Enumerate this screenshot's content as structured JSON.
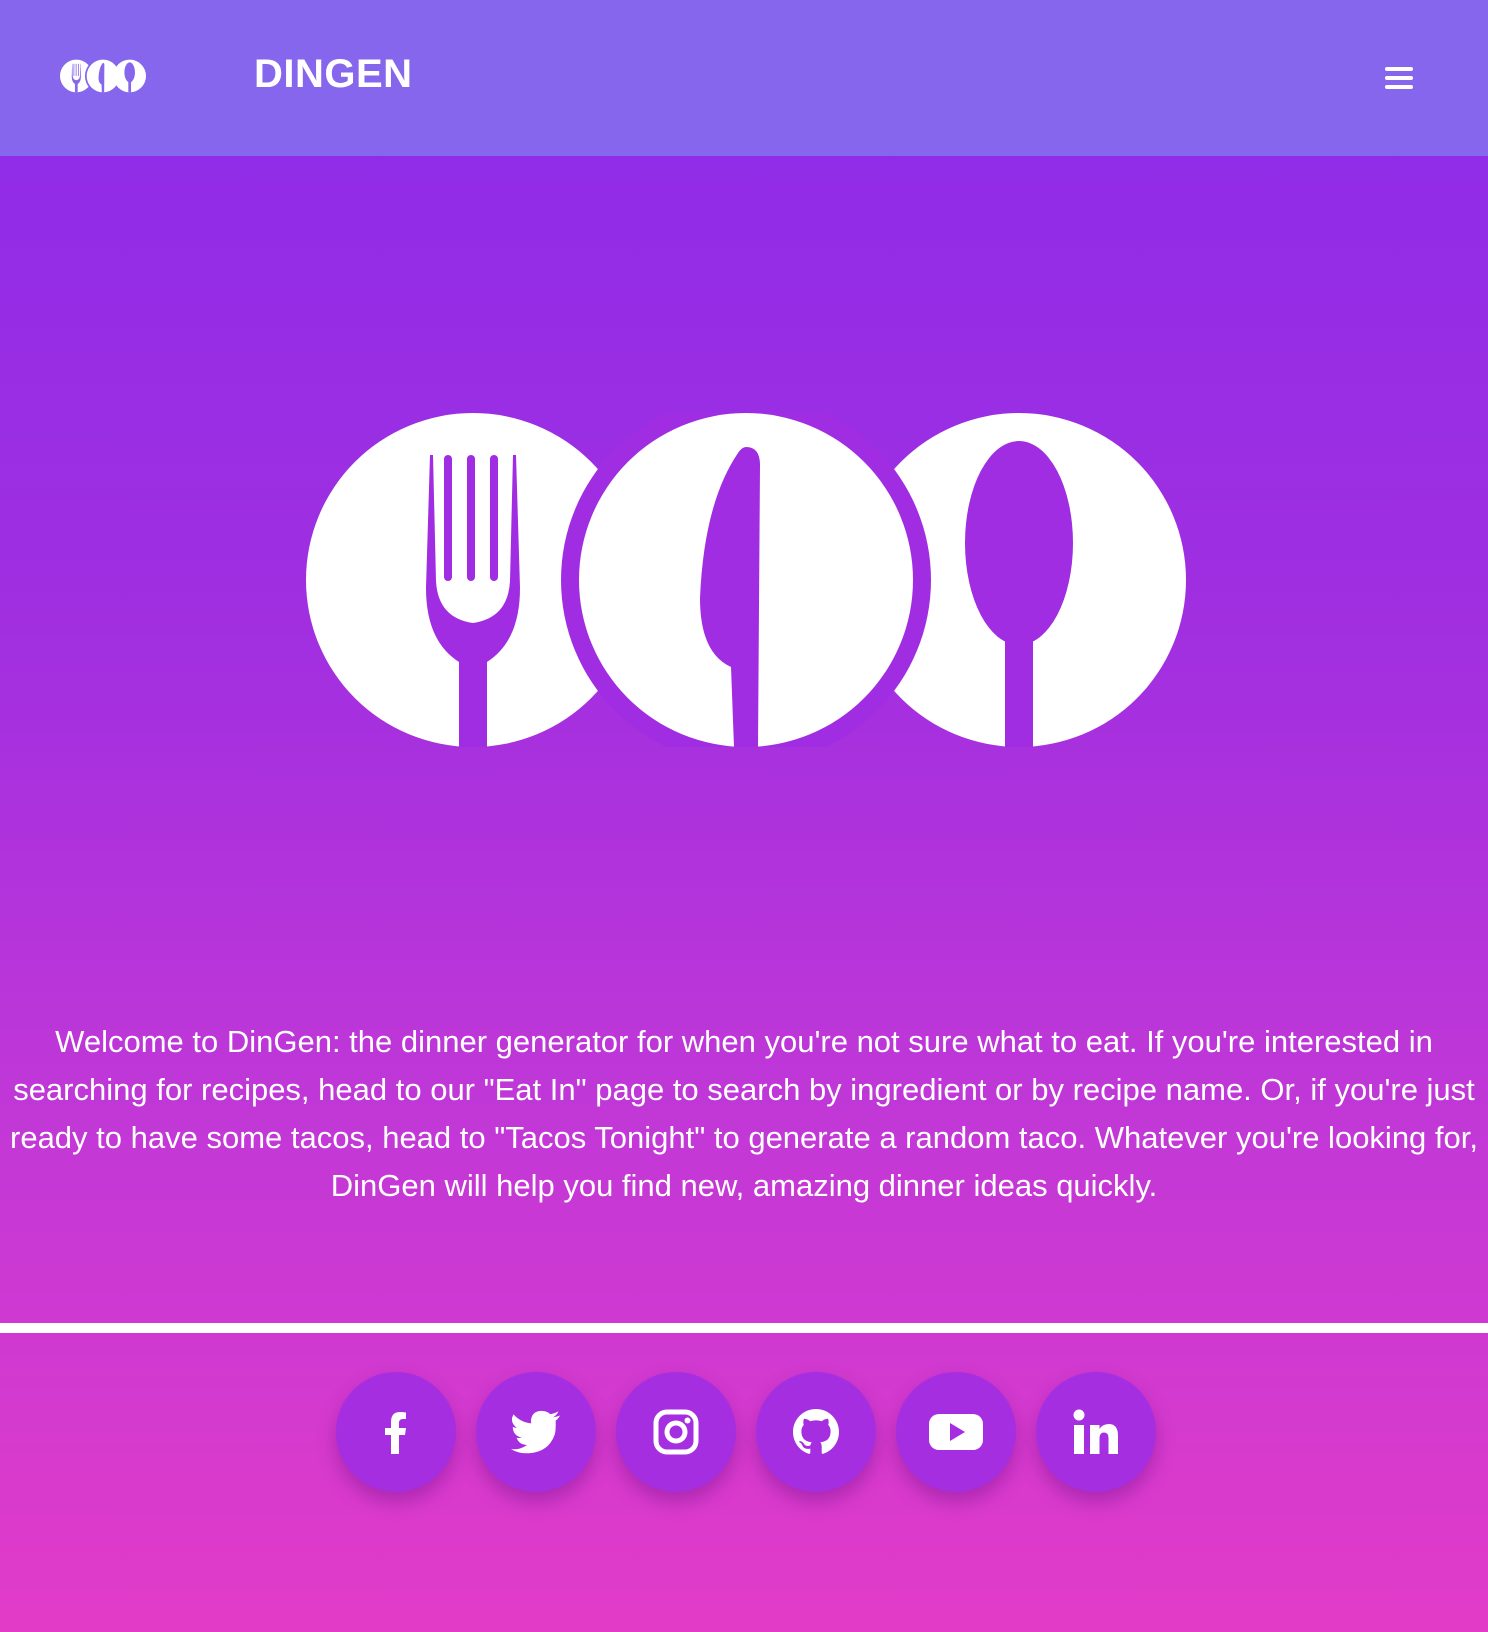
{
  "header": {
    "brand": "DINGEN",
    "logo_icon": "fork-knife-spoon-logo-icon",
    "menu_icon": "hamburger-menu-icon"
  },
  "hero": {
    "logo_icon": "fork-knife-spoon-logo-icon",
    "welcome_text": "Welcome to DinGen: the dinner generator for when you're not sure what to eat. If you're interested in searching for recipes, head to our \"Eat In\" page to search by ingredient or by recipe name. Or, if you're just ready to have some tacos, head to \"Tacos Tonight\" to generate a random taco. Whatever you're looking for, DinGen will help you find new, amazing dinner ideas quickly."
  },
  "social": [
    {
      "icon": "facebook-icon"
    },
    {
      "icon": "twitter-icon"
    },
    {
      "icon": "instagram-icon"
    },
    {
      "icon": "github-icon"
    },
    {
      "icon": "youtube-icon"
    },
    {
      "icon": "linkedin-icon"
    }
  ],
  "colors": {
    "navbar": "#8666ec",
    "gradient_top": "#8b2bea",
    "gradient_bottom": "#e23bc8",
    "social_button": "#a52ee0",
    "text": "#ffffff"
  }
}
